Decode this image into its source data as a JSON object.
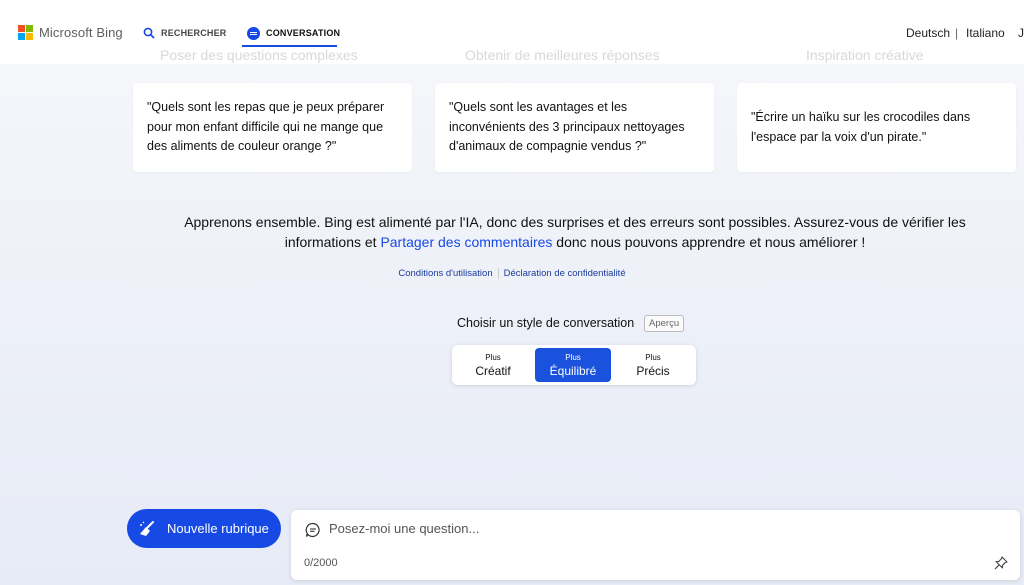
{
  "header": {
    "brand": "Microsoft Bing",
    "tabs": [
      {
        "label": "RECHERCHER",
        "active": false
      },
      {
        "label": "CONVERSATION",
        "active": true
      }
    ],
    "languages": [
      "Deutsch",
      "|",
      "Italiano",
      "J"
    ]
  },
  "suggestions": {
    "headings": [
      "Poser des questions complexes",
      "Obtenir de meilleures réponses",
      "Inspiration créative"
    ],
    "cards": [
      {
        "text": "\"Quels sont les repas que je peux préparer pour mon enfant difficile qui ne mange que des aliments de couleur orange ?\""
      },
      {
        "text": "\"Quels sont les avantages et les inconvénients des 3 principaux nettoyages d'animaux de compagnie vendus ?\""
      },
      {
        "text": "\"Écrire un haïku sur les crocodiles dans l'espace par la voix d'un pirate.\""
      }
    ]
  },
  "disclaimer": {
    "before": "Apprenons ensemble. Bing est alimenté par l'IA, donc des surprises et des erreurs sont possibles. Assurez-vous de vérifier les informations et ",
    "link": "Partager des commentaires",
    "after": " donc nous pouvons apprendre et nous améliorer !"
  },
  "legal": {
    "terms": "Conditions d'utilisation",
    "privacy": "Déclaration de confidentialité"
  },
  "style_selector": {
    "title": "Choisir un style de conversation",
    "badge": "Aperçu",
    "options": [
      {
        "small": "Plus",
        "label": "Créatif",
        "selected": false
      },
      {
        "small": "Plus",
        "label": "Équilibré",
        "selected": true
      },
      {
        "small": "Plus",
        "label": "Précis",
        "selected": false
      }
    ]
  },
  "composer": {
    "new_topic_label": "Nouvelle rubrique",
    "placeholder": "Posez-moi une question...",
    "counter": "0/2000"
  },
  "colors": {
    "accent": "#174ae4",
    "selected_option": "#1a52de",
    "link": "#1a3b9c"
  }
}
